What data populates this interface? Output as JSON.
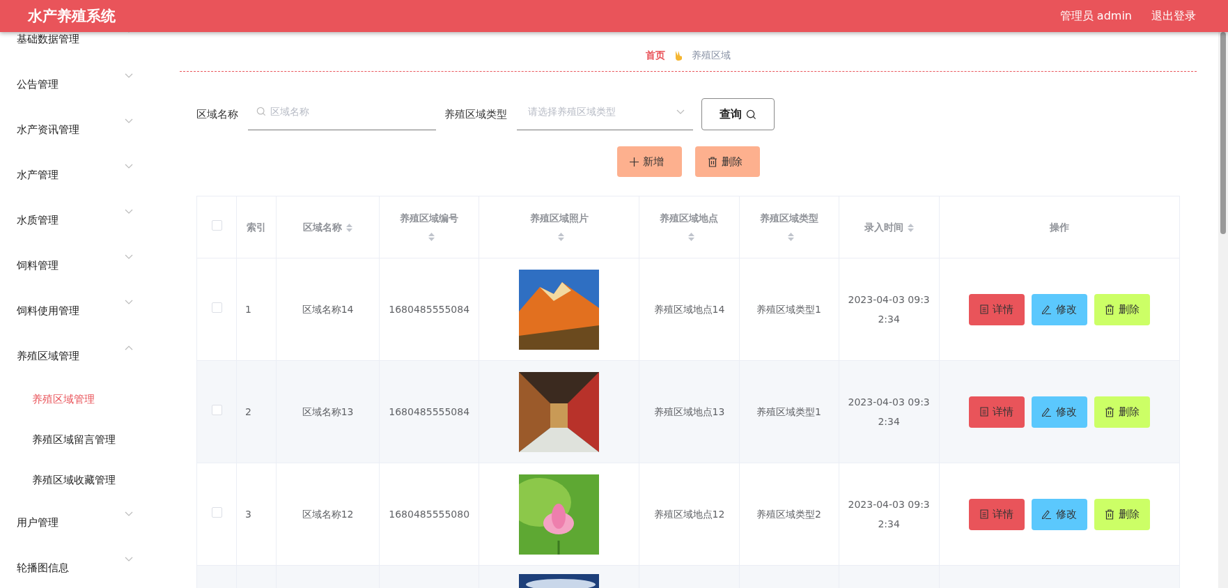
{
  "header": {
    "title": "水产养殖系统",
    "user": "管理员 admin",
    "logout": "退出登录"
  },
  "sidebar": {
    "items": [
      {
        "label": "基础数据管理",
        "expanded": false
      },
      {
        "label": "公告管理",
        "expanded": false
      },
      {
        "label": "水产资讯管理",
        "expanded": false
      },
      {
        "label": "水产管理",
        "expanded": false
      },
      {
        "label": "水质管理",
        "expanded": false
      },
      {
        "label": "饲料管理",
        "expanded": false
      },
      {
        "label": "饲料使用管理",
        "expanded": false
      },
      {
        "label": "养殖区域管理",
        "expanded": true,
        "children": [
          {
            "label": "养殖区域管理",
            "selected": true
          },
          {
            "label": "养殖区域留言管理",
            "selected": false
          },
          {
            "label": "养殖区域收藏管理",
            "selected": false
          }
        ]
      },
      {
        "label": "用户管理",
        "expanded": false
      },
      {
        "label": "轮播图信息",
        "expanded": false
      }
    ]
  },
  "breadcrumb": {
    "home": "首页",
    "current": "养殖区域"
  },
  "search": {
    "name_label": "区域名称",
    "name_placeholder": "区域名称",
    "type_label": "养殖区域类型",
    "type_placeholder": "请选择养殖区域类型",
    "query_button": "查询"
  },
  "actions": {
    "add": "新增",
    "delete": "删除"
  },
  "table": {
    "columns": [
      {
        "kind": "checkbox",
        "checked": false
      },
      {
        "kind": "text",
        "label": "索引",
        "sortable": false
      },
      {
        "kind": "text",
        "label": "区域名称",
        "sortable": true
      },
      {
        "kind": "text",
        "label": "养殖区域编号",
        "sortable": true
      },
      {
        "kind": "text",
        "label": "养殖区域照片",
        "sortable": true
      },
      {
        "kind": "text",
        "label": "养殖区域地点",
        "sortable": true
      },
      {
        "kind": "text",
        "label": "养殖区域类型",
        "sortable": true
      },
      {
        "kind": "text",
        "label": "录入时间",
        "sortable": true
      },
      {
        "kind": "text",
        "label": "操作",
        "sortable": false
      }
    ],
    "rows": [
      {
        "checked": false,
        "index": "1",
        "name": "区域名称14",
        "code": "1680485555084",
        "photo": {
          "kind": "picture"
        },
        "place": "养殖区域地点14",
        "type": "养殖区域类型1",
        "time": "2023-04-03 09:32:34",
        "buttons": [
          "详情",
          "修改",
          "删除"
        ]
      },
      {
        "checked": false,
        "index": "2",
        "name": "区域名称13",
        "code": "1680485555084",
        "photo": {
          "kind": "picture"
        },
        "place": "养殖区域地点13",
        "type": "养殖区域类型1",
        "time": "2023-04-03 09:32:34",
        "buttons": [
          "详情",
          "修改",
          "删除"
        ]
      },
      {
        "checked": false,
        "index": "3",
        "name": "区域名称12",
        "code": "1680485555080",
        "photo": {
          "kind": "picture"
        },
        "place": "养殖区域地点12",
        "type": "养殖区域类型2",
        "time": "2023-04-03 09:32:34",
        "buttons": [
          "详情",
          "修改",
          "删除"
        ]
      },
      {
        "photo": {
          "kind": "picture"
        }
      }
    ]
  }
}
